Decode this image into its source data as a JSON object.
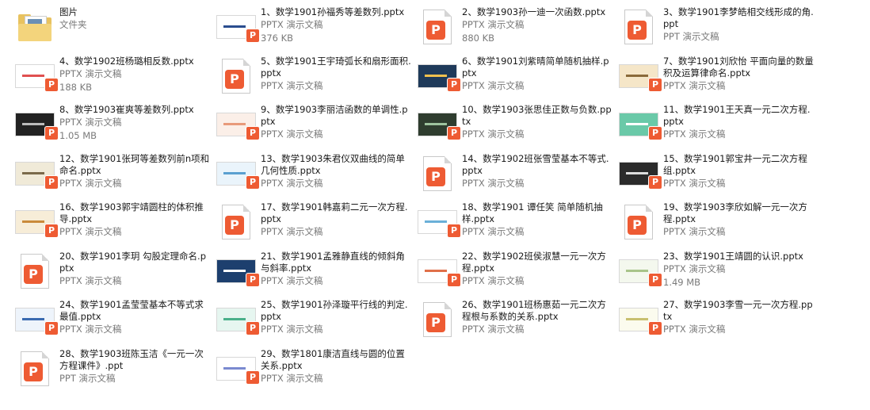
{
  "items": [
    {
      "name": "图片",
      "type": "文件夹",
      "size": "",
      "icon": "folder-icon",
      "thumb": "folder",
      "c1": "",
      "c2": ""
    },
    {
      "name": "1、数学1901孙福秀等差数列.pptx",
      "type": "PPTX 演示文稿",
      "size": "376 KB",
      "icon": "slide-thumbnail",
      "thumb": "slide",
      "c1": "#ffffff",
      "c2": "#2a4d8f"
    },
    {
      "name": "2、数学1903孙一迪一次函数.pptx",
      "type": "PPTX 演示文稿",
      "size": "880 KB",
      "icon": "powerpoint-file-icon",
      "thumb": "doc",
      "c1": "",
      "c2": ""
    },
    {
      "name": "3、数学1901李梦皓相交线形成的角.ppt",
      "type": "PPT 演示文稿",
      "size": "",
      "icon": "powerpoint-file-icon",
      "thumb": "doc",
      "c1": "",
      "c2": ""
    },
    {
      "name": "4、数学1902班杨璐相反数.pptx",
      "type": "PPTX 演示文稿",
      "size": "188 KB",
      "icon": "slide-thumbnail",
      "thumb": "slide",
      "c1": "#ffffff",
      "c2": "#e05050"
    },
    {
      "name": "5、数学1901王宇琦弧长和扇形面积.pptx",
      "type": "PPTX 演示文稿",
      "size": "",
      "icon": "powerpoint-file-icon",
      "thumb": "doc",
      "c1": "",
      "c2": ""
    },
    {
      "name": "6、数学1901刘紫晴简单随机抽样.pptx",
      "type": "PPTX 演示文稿",
      "size": "",
      "icon": "slide-thumbnail",
      "thumb": "slide",
      "c1": "#1f3a5a",
      "c2": "#f2c14e"
    },
    {
      "name": "7、数学1901刘欣怡 平面向量的数量积及运算律命名.pptx",
      "type": "PPTX 演示文稿",
      "size": "",
      "icon": "slide-thumbnail",
      "thumb": "slide",
      "c1": "#f5e6c8",
      "c2": "#8a6a3a"
    },
    {
      "name": "8、数学1903崔爽等差数列.pptx",
      "type": "PPTX 演示文稿",
      "size": "1.05 MB",
      "icon": "slide-thumbnail",
      "thumb": "slide",
      "c1": "#222222",
      "c2": "#bbbbbb"
    },
    {
      "name": "9、数学1903李丽洁函数的单调性.pptx",
      "type": "PPTX 演示文稿",
      "size": "",
      "icon": "slide-thumbnail",
      "thumb": "slide",
      "c1": "#fbefe8",
      "c2": "#e89a7a"
    },
    {
      "name": "10、数学1903张思佳正数与负数.pptx",
      "type": "PPTX 演示文稿",
      "size": "",
      "icon": "slide-thumbnail",
      "thumb": "slide",
      "c1": "#2f3d2f",
      "c2": "#9ec39e"
    },
    {
      "name": "11、数学1901王天真一元二次方程.pptx",
      "type": "PPTX 演示文稿",
      "size": "",
      "icon": "slide-thumbnail",
      "thumb": "slide",
      "c1": "#6ac9a8",
      "c2": "#ffffff"
    },
    {
      "name": "12、数学1901张珂等差数列前n项和命名.pptx",
      "type": "PPTX 演示文稿",
      "size": "",
      "icon": "slide-thumbnail",
      "thumb": "slide",
      "c1": "#f0ead8",
      "c2": "#7a6a4a"
    },
    {
      "name": "13、数学1903朱君仪双曲线的简单几何性质.pptx",
      "type": "PPTX 演示文稿",
      "size": "",
      "icon": "slide-thumbnail",
      "thumb": "slide",
      "c1": "#eaf4fb",
      "c2": "#5aa0d0"
    },
    {
      "name": "14、数学1902班张雪莹基本不等式.pptx",
      "type": "PPTX 演示文稿",
      "size": "",
      "icon": "powerpoint-file-icon",
      "thumb": "doc",
      "c1": "",
      "c2": ""
    },
    {
      "name": "15、数学1901郭宝井一元二次方程组.pptx",
      "type": "PPTX 演示文稿",
      "size": "",
      "icon": "slide-thumbnail",
      "thumb": "slide",
      "c1": "#2b2b2b",
      "c2": "#dddddd"
    },
    {
      "name": "16、数学1903郭宇靖圆柱的体积推导.pptx",
      "type": "PPTX 演示文稿",
      "size": "",
      "icon": "slide-thumbnail",
      "thumb": "slide",
      "c1": "#f7edd8",
      "c2": "#c98a3a"
    },
    {
      "name": "17、数学1901韩嘉莉二元一次方程.pptx",
      "type": "PPTX 演示文稿",
      "size": "",
      "icon": "powerpoint-file-icon",
      "thumb": "doc",
      "c1": "",
      "c2": ""
    },
    {
      "name": "18、数学1901 谭任笑 简单随机抽样.pptx",
      "type": "PPTX 演示文稿",
      "size": "",
      "icon": "slide-thumbnail",
      "thumb": "slide",
      "c1": "#ffffff",
      "c2": "#6ab0d8"
    },
    {
      "name": "19、数学1903李欣如解一元一次方程.pptx",
      "type": "PPTX 演示文稿",
      "size": "",
      "icon": "powerpoint-file-icon",
      "thumb": "doc",
      "c1": "",
      "c2": ""
    },
    {
      "name": "20、数学1901李玥 勾股定理命名.pptx",
      "type": "PPTX 演示文稿",
      "size": "",
      "icon": "powerpoint-file-icon",
      "thumb": "doc",
      "c1": "",
      "c2": ""
    },
    {
      "name": "21、数学1901孟雅静直线的倾斜角与斜率.pptx",
      "type": "PPTX 演示文稿",
      "size": "",
      "icon": "slide-thumbnail",
      "thumb": "slide",
      "c1": "#1d3f6e",
      "c2": "#ffffff"
    },
    {
      "name": "22、数学1902班侯淑慧一元一次方程.pptx",
      "type": "PPTX 演示文稿",
      "size": "",
      "icon": "slide-thumbnail",
      "thumb": "slide",
      "c1": "#ffffff",
      "c2": "#e0704a"
    },
    {
      "name": "23、数学1901王靖圆的认识.pptx",
      "type": "PPTX 演示文稿",
      "size": "1.49 MB",
      "icon": "slide-thumbnail",
      "thumb": "slide",
      "c1": "#f4f8ee",
      "c2": "#a8c48a"
    },
    {
      "name": "24、数学1901孟莹莹基本不等式求最值.pptx",
      "type": "PPTX 演示文稿",
      "size": "",
      "icon": "slide-thumbnail",
      "thumb": "slide",
      "c1": "#eef4fb",
      "c2": "#3a6ab0"
    },
    {
      "name": "25、数学1901孙泽璇平行线的判定.pptx",
      "type": "PPTX 演示文稿",
      "size": "",
      "icon": "slide-thumbnail",
      "thumb": "slide",
      "c1": "#e6f6f0",
      "c2": "#4ab08a"
    },
    {
      "name": "26、数学1901班杨惠茹一元二次方程根与系数的关系.pptx",
      "type": "PPTX 演示文稿",
      "size": "",
      "icon": "powerpoint-file-icon",
      "thumb": "doc",
      "c1": "",
      "c2": ""
    },
    {
      "name": "27、数学1903李雪一元一次方程.pptx",
      "type": "PPTX 演示文稿",
      "size": "",
      "icon": "slide-thumbnail",
      "thumb": "slide",
      "c1": "#fbfbee",
      "c2": "#c8c070"
    },
    {
      "name": "28、数学1903班陈玉洁《一元一次方程课件》.ppt",
      "type": "PPT 演示文稿",
      "size": "",
      "icon": "powerpoint-file-icon",
      "thumb": "doc",
      "c1": "",
      "c2": ""
    },
    {
      "name": "29、数学1801康洁直线与圆的位置关系.pptx",
      "type": "PPTX 演示文稿",
      "size": "",
      "icon": "slide-thumbnail",
      "thumb": "slide",
      "c1": "#ffffff",
      "c2": "#7a8ad0"
    }
  ]
}
